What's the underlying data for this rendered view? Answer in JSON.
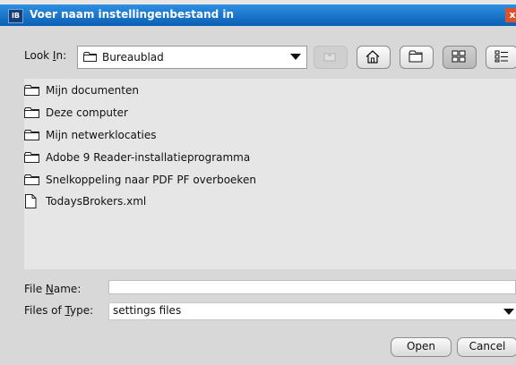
{
  "window": {
    "icon_text": "IB",
    "title": "Voer naam instellingenbestand in",
    "close_glyph": "x"
  },
  "look_in": {
    "label_pre": "Look ",
    "label_mnemonic": "I",
    "label_post": "n:",
    "value": "Bureaublad"
  },
  "toolbar": {
    "icons": [
      "up-folder-icon",
      "home-icon",
      "new-folder-icon",
      "list-view-icon",
      "details-view-icon"
    ]
  },
  "files": [
    {
      "name": "Mijn documenten",
      "icon": "folder-icon"
    },
    {
      "name": "Deze computer",
      "icon": "folder-icon"
    },
    {
      "name": "Mijn netwerklocaties",
      "icon": "folder-icon"
    },
    {
      "name": "Adobe 9 Reader-installatieprogramma",
      "icon": "folder-icon"
    },
    {
      "name": "Snelkoppeling naar PDF PF overboeken",
      "icon": "folder-icon"
    },
    {
      "name": "TodaysBrokers.xml",
      "icon": "file-icon"
    }
  ],
  "file_name": {
    "label_pre": "File ",
    "label_mnemonic": "N",
    "label_post": "ame:",
    "value": ""
  },
  "file_type": {
    "label_pre": "Files of ",
    "label_mnemonic": "T",
    "label_post": "ype:",
    "value": "settings files"
  },
  "buttons": {
    "open": "Open",
    "cancel": "Cancel"
  },
  "colors": {
    "title_bar": "#1e78d2",
    "dialog_bg": "#d8d8d8",
    "close_button": "#d9532c"
  }
}
